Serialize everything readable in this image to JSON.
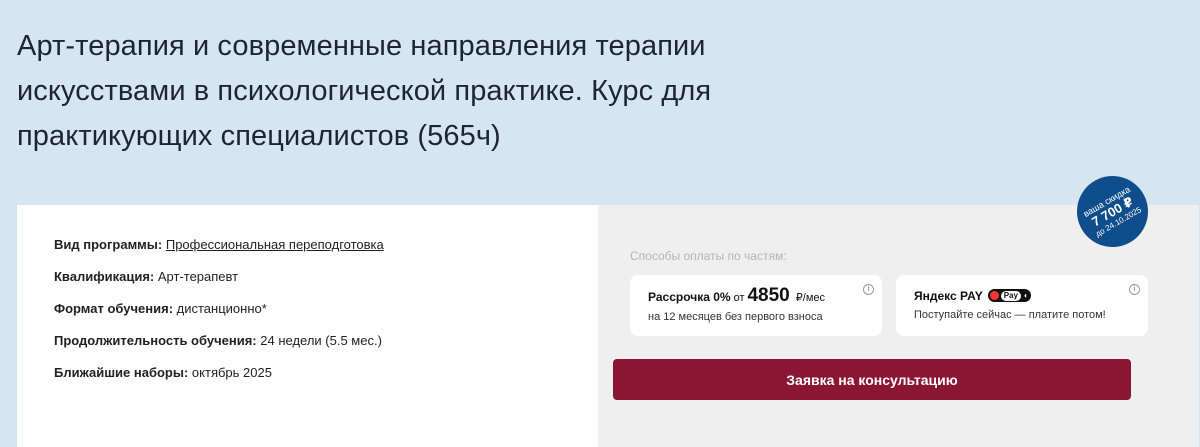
{
  "page_title": "Арт-терапия и современные направления терапии искусствами в психологической практике. Курс для практикующих специалистов (565ч)",
  "info": [
    {
      "label": "Вид программы:",
      "value": "Профессиональная переподготовка"
    },
    {
      "label": "Квалификация:",
      "value": "Арт-терапевт"
    },
    {
      "label": "Формат обучения:",
      "value": "дистанционно*"
    },
    {
      "label": "Продолжительность обучения:",
      "value": "24 недели (5.5 мес.)"
    },
    {
      "label": "Ближайшие наборы:",
      "value": "октябрь 2025"
    }
  ],
  "payment": {
    "label": "Способы оплаты по частям:",
    "installment": {
      "title": "Рассрочка 0%",
      "from": "от",
      "amount": "4850",
      "unit": "₽/мес",
      "sub": "на 12 месяцев без первого взноса"
    },
    "yandex": {
      "title": "Яндекс PAY",
      "badge_text": "Pay",
      "sub": "Поступайте сейчас — платите потом!"
    },
    "info_glyph": "i"
  },
  "cta_label": "Заявка на консультацию",
  "discount": {
    "line1": "ваша скидка",
    "amount": "7 700 ₽",
    "until": "до 24.10.2025"
  },
  "colors": {
    "background": "#d6e6f1",
    "accent": "#8b1631",
    "badge": "#0f4d8d"
  }
}
